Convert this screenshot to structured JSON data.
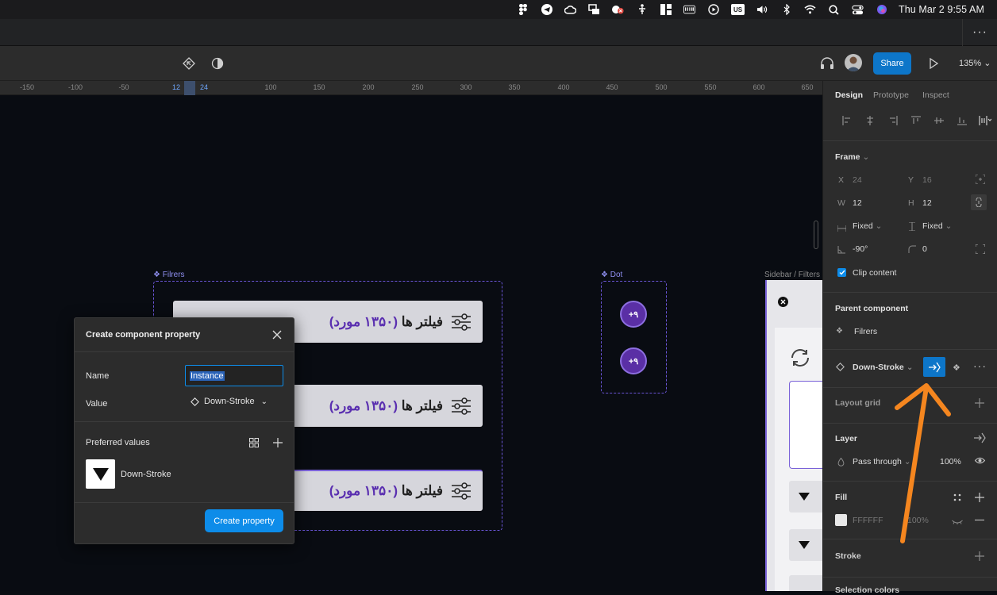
{
  "menubar": {
    "clock": "Thu Mar 2  9:55 AM",
    "icons": [
      "figma-icon",
      "telegram-icon",
      "creative-cloud-icon",
      "screen-share-icon",
      "camera-blocked-icon",
      "accessibility-icon",
      "widget-icon",
      "keyboard-icon",
      "play-circle-icon",
      "us-input-icon",
      "volume-icon",
      "bluetooth-icon",
      "wifi-icon",
      "search-icon",
      "control-center-icon",
      "siri-icon"
    ],
    "input_source": "US"
  },
  "tabstrip": {
    "more_label": "···"
  },
  "toolbar": {
    "share_label": "Share",
    "zoom_label": "135%"
  },
  "ruler": {
    "ticks": [
      "-150",
      "-100",
      "-50",
      "12",
      "24",
      "100",
      "150",
      "200",
      "250",
      "300",
      "350",
      "400",
      "450",
      "500",
      "550",
      "600",
      "650"
    ]
  },
  "canvas": {
    "frames": {
      "filrers": "Filrers",
      "dot": "Dot",
      "sidebar": "Sidebar / Filters"
    },
    "filter_item": {
      "text": "فیلتر ها",
      "count": "(۱۳۵۰ مورد)"
    },
    "dot_badge": "+۹"
  },
  "dialog": {
    "title": "Create component property",
    "name_label": "Name",
    "name_value": "Instance",
    "value_label": "Value",
    "value_selected": "Down-Stroke",
    "preferred_label": "Preferred values",
    "preferred_item": "Down-Stroke",
    "create_label": "Create property"
  },
  "panel": {
    "tabs": [
      "Design",
      "Prototype",
      "Inspect"
    ],
    "frame": {
      "title": "Frame",
      "x_label": "X",
      "x": "24",
      "y_label": "Y",
      "y": "16",
      "w_label": "W",
      "w": "12",
      "h_label": "H",
      "h": "12",
      "hresize": "Fixed",
      "vresize": "Fixed",
      "rotation": "-90°",
      "radius": "0",
      "clip": "Clip content"
    },
    "parent": {
      "title": "Parent component",
      "name": "Filrers"
    },
    "instance": {
      "name": "Down-Stroke"
    },
    "layout_grid": "Layout grid",
    "layer": {
      "title": "Layer",
      "blend": "Pass through",
      "opacity": "100%"
    },
    "fill": {
      "title": "Fill",
      "hex": "FFFFFF",
      "opacity": "100%"
    },
    "stroke": "Stroke",
    "selection_colors": "Selection colors"
  },
  "colors": {
    "accent": "#0d8ce9",
    "arrow": "#f5861f",
    "component": "#6a55d6"
  }
}
